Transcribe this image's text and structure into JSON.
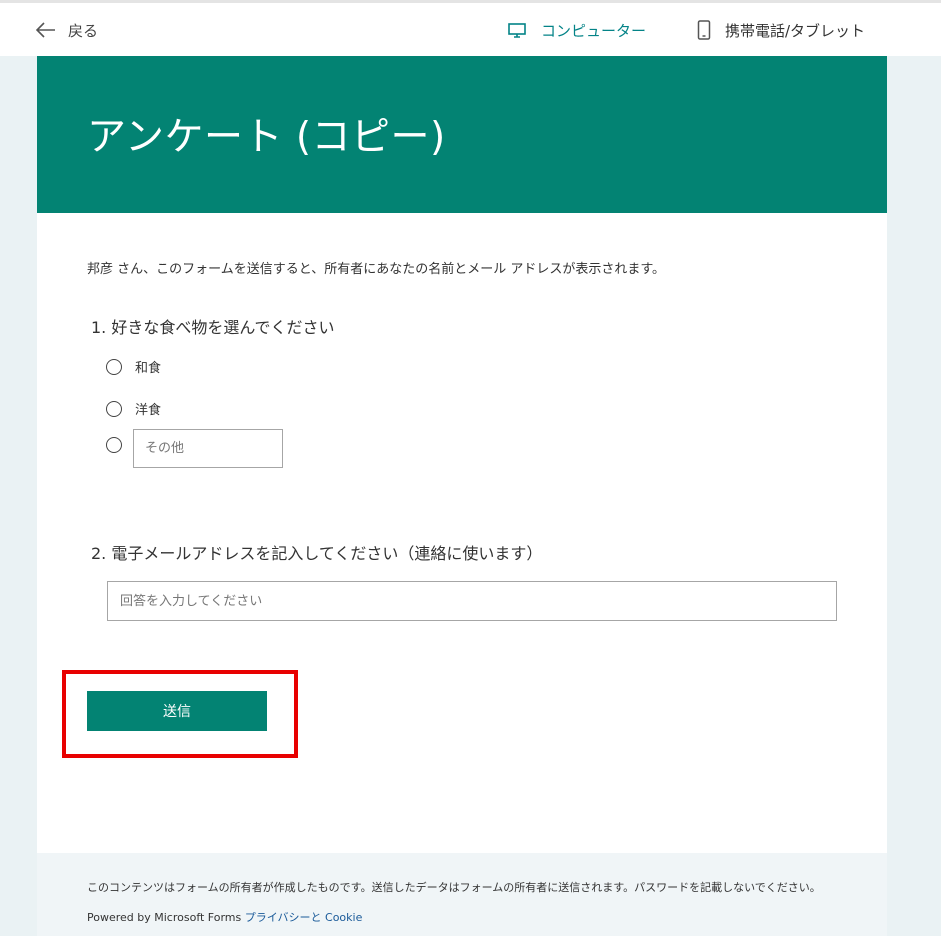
{
  "nav": {
    "back_label": "戻る",
    "computer_label": "コンピューター",
    "mobile_label": "携帯電話/タブレット"
  },
  "form": {
    "title": "アンケート (コピー)",
    "notice": "邦彦 さん、このフォームを送信すると、所有者にあなたの名前とメール アドレスが表示されます。",
    "questions": [
      {
        "label": "1. 好きな食べ物を選んでください",
        "options": [
          "和食",
          "洋食"
        ],
        "other_placeholder": "その他"
      },
      {
        "label": "2. 電子メールアドレスを記入してください（連絡に使います）",
        "placeholder": "回答を入力してください"
      }
    ],
    "submit_label": "送信"
  },
  "footer": {
    "disclaimer": "このコンテンツはフォームの所有者が作成したものです。送信したデータはフォームの所有者に送信されます。パスワードを記載しないでください。",
    "powered_by": "Powered by Microsoft Forms",
    "privacy_link": "プライバシーと Cookie"
  },
  "colors": {
    "accent": "#038373",
    "highlight": "#e80000",
    "link": "#1a5a99"
  }
}
